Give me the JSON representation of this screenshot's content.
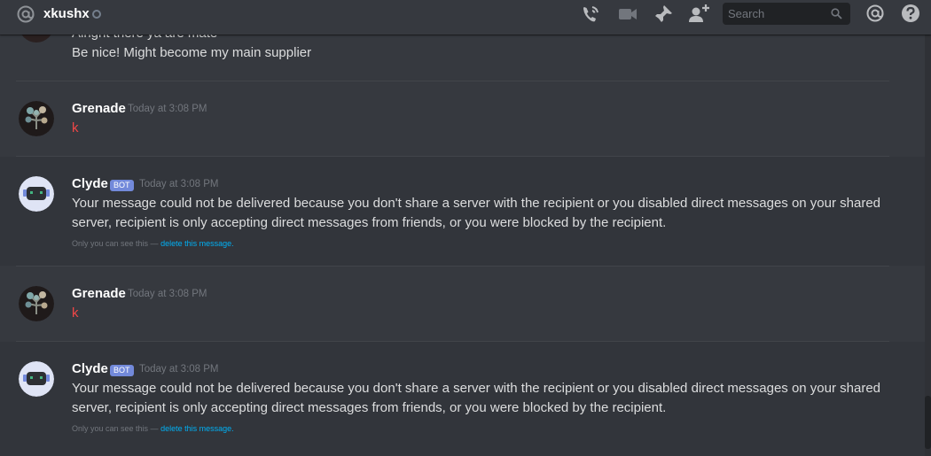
{
  "header": {
    "username": "xkushx",
    "search_placeholder": "Search"
  },
  "icons": {
    "at": "at-icon",
    "status": "offline-status-icon",
    "call": "voice-call-icon",
    "video": "video-call-icon",
    "pin": "pin-icon",
    "add_friend": "add-friend-icon",
    "search": "search-icon",
    "mentions": "mentions-icon",
    "help": "help-icon"
  },
  "colors": {
    "background": "#36393f",
    "highlight_row": "#32353b",
    "bot_tag": "#7289da",
    "link": "#00b0f4",
    "red_text": "#f04747"
  },
  "messages": {
    "previous_tail": {
      "line1": "Alright there ya are mate",
      "line2": "Be nice! Might become my main supplier"
    },
    "groups": [
      {
        "author": "Grenade",
        "timestamp": "Today at 3:08 PM",
        "content": "k"
      },
      {
        "author": "Clyde",
        "bot_tag": "BOT",
        "timestamp": "Today at 3:08 PM",
        "content_line1": "Your message could not be delivered because you don't share a server with the recipient or you disabled direct messages on your shared",
        "content_line2": "server, recipient is only accepting direct messages from friends, or you were blocked by the recipient.",
        "ephemeral_note": "Only you can see this —",
        "ephemeral_link": "delete this message."
      },
      {
        "author": "Grenade",
        "timestamp": "Today at 3:08 PM",
        "content": "k"
      },
      {
        "author": "Clyde",
        "bot_tag": "BOT",
        "timestamp": "Today at 3:08 PM",
        "content_line1": "Your message could not be delivered because you don't share a server with the recipient or you disabled direct messages on your shared",
        "content_line2": "server, recipient is only accepting direct messages from friends, or you were blocked by the recipient.",
        "ephemeral_note": "Only you can see this —",
        "ephemeral_link": "delete this message."
      }
    ]
  }
}
